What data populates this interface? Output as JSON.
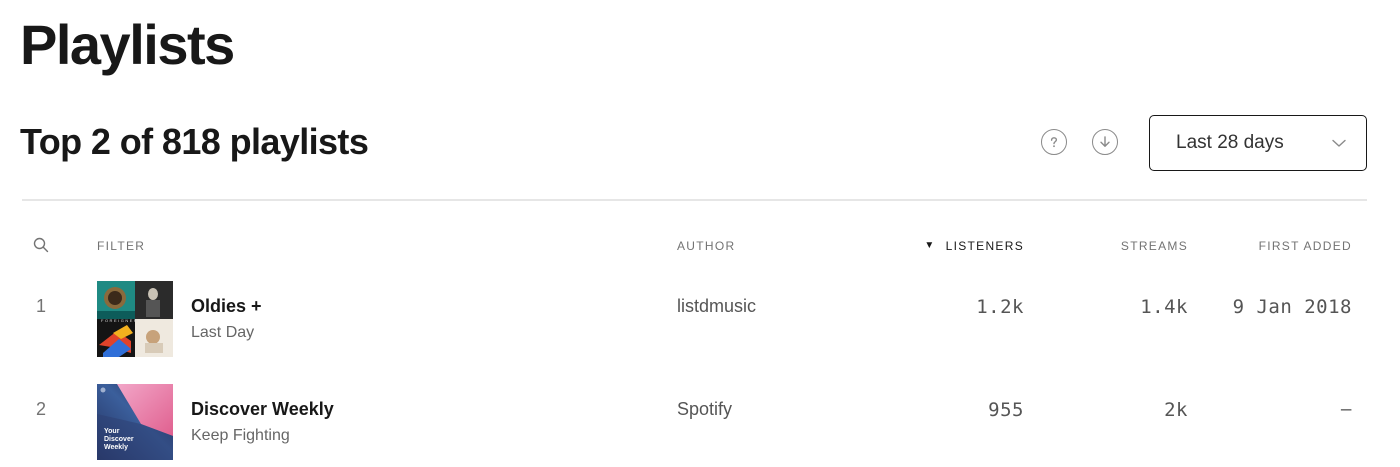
{
  "page": {
    "title": "Playlists"
  },
  "section": {
    "title": "Top 2 of 818 playlists",
    "help_icon": "question-circle-icon",
    "download_icon": "download-circle-icon",
    "date_range": {
      "selected": "Last 28 days",
      "icon": "chevron-down-icon"
    }
  },
  "table": {
    "search_icon": "search-icon",
    "headers": {
      "filter": "FILTER",
      "author": "AUTHOR",
      "listeners": "LISTENERS",
      "streams": "STREAMS",
      "first_added": "FIRST ADDED"
    },
    "sort": {
      "column": "listeners",
      "direction": "descending",
      "indicator": "▼"
    },
    "rows": [
      {
        "rank": "1",
        "name": "Oldies +",
        "subtitle": "Last Day",
        "author": "listdmusic",
        "listeners": "1.2k",
        "streams": "1.4k",
        "first_added": "9 Jan 2018",
        "art": {
          "type": "collage",
          "text": "FOREIGNER"
        }
      },
      {
        "rank": "2",
        "name": "Discover Weekly",
        "subtitle": "Keep Fighting",
        "author": "Spotify",
        "listeners": "955",
        "streams": "2k",
        "first_added": "–",
        "art": {
          "type": "gradient",
          "lines": [
            "Your",
            "Discover",
            "Weekly"
          ]
        }
      }
    ]
  },
  "colors": {
    "text": "#181818",
    "muted": "#737373",
    "divider": "#e6e6e6"
  }
}
